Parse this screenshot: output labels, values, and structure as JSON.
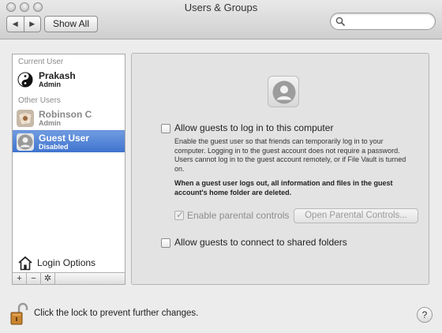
{
  "window": {
    "title": "Users & Groups"
  },
  "toolbar": {
    "back_glyph": "◀",
    "forward_glyph": "▶",
    "show_all_label": "Show All",
    "search_placeholder": ""
  },
  "sidebar": {
    "current_user_label": "Current User",
    "current_user": {
      "name": "Prakash",
      "role": "Admin",
      "avatar_icon": "yin-yang-icon"
    },
    "other_users_label": "Other Users",
    "other_users": [
      {
        "name": "Robinson C",
        "role": "Admin",
        "avatar_icon": "flower-icon",
        "dimmed": true
      },
      {
        "name": "Guest User",
        "role": "Disabled",
        "avatar_icon": "person-silhouette-icon",
        "selected": true
      }
    ],
    "login_options_label": "Login Options",
    "tools": [
      "+",
      "−",
      "✲"
    ]
  },
  "panel": {
    "allow_guests_label": "Allow guests to log in to this computer",
    "allow_guests_checked": false,
    "guest_description": "Enable the guest user so that friends can temporarily log in to your computer. Logging in to the guest account does not require a password. Users cannot log in to the guest account remotely, or if File Vault is turned on.",
    "guest_warning": "When a guest user logs out, all information and files in the guest account's home folder are deleted.",
    "parental_controls_label": "Enable parental controls",
    "parental_controls_checked": true,
    "open_parental_controls_label": "Open Parental Controls...",
    "shared_folders_label": "Allow guests to connect to shared folders",
    "shared_folders_checked": false
  },
  "footer": {
    "lock_text": "Click the lock to prevent further changes.",
    "help_label": "?"
  },
  "colors": {
    "selection": "#3f74cf",
    "panel": "#e3e3e3"
  }
}
